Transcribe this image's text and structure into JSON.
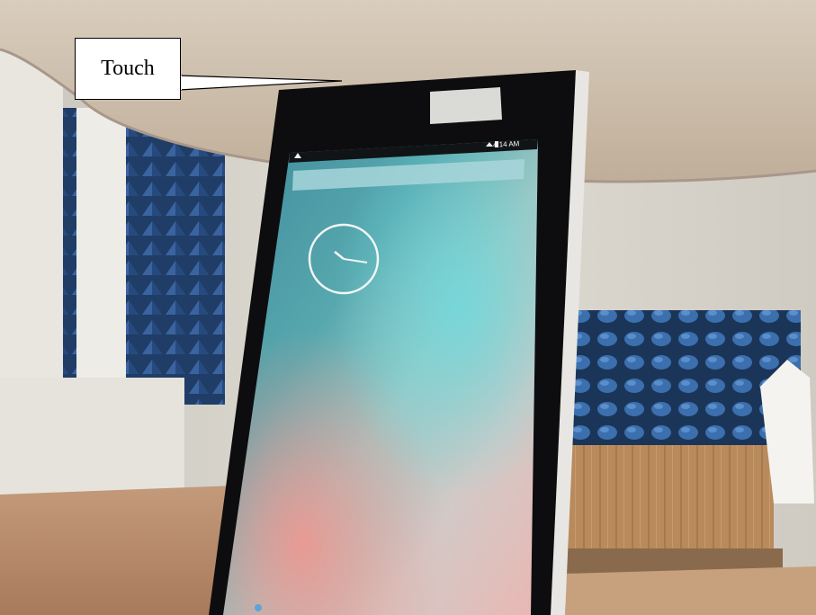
{
  "photo": {
    "description_label": "Touch",
    "status_bar": {
      "time": "4:14 AM",
      "wifi_icon": "wifi-icon",
      "battery_icon": "battery-icon"
    },
    "homescreen": {
      "clock_widget": "analog-clock-icon"
    }
  },
  "colors": {
    "table_top": "#cdbfae",
    "absorber_blue": "#2a4c78",
    "wall": "#d8d5cc",
    "phone_bezel": "#0d0d0f",
    "screen_teal": "#3d8ea0"
  }
}
